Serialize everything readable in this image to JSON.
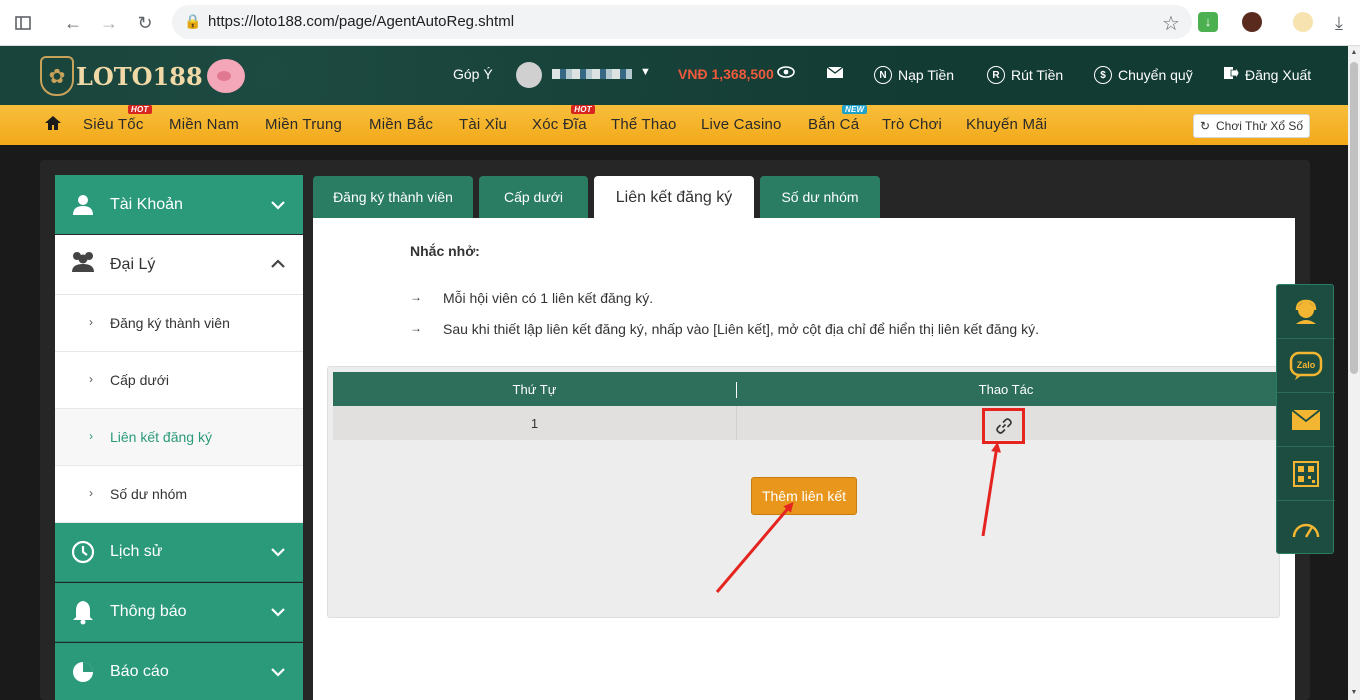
{
  "browser": {
    "url": "https://loto188.com/page/AgentAutoReg.shtml"
  },
  "header": {
    "logo_text": "LOTO188",
    "feedback": "Góp Ý",
    "balance": "VNĐ 1,368,500",
    "deposit": "Nạp Tiền",
    "deposit_icon_letter": "N",
    "withdraw": "Rút Tiền",
    "withdraw_icon_letter": "R",
    "transfer": "Chuyển quỹ",
    "logout": "Đăng Xuất"
  },
  "nav": {
    "items": [
      {
        "label": "Siêu Tốc",
        "badge": "HOT"
      },
      {
        "label": "Miền Nam"
      },
      {
        "label": "Miền Trung"
      },
      {
        "label": "Miền Bắc"
      },
      {
        "label": "Tài Xỉu"
      },
      {
        "label": "Xóc Đĩa",
        "badge": "HOT"
      },
      {
        "label": "Thể Thao"
      },
      {
        "label": "Live Casino"
      },
      {
        "label": "Bắn Cá",
        "badge": "NEW"
      },
      {
        "label": "Trò Chơi"
      },
      {
        "label": "Khuyến Mãi"
      }
    ],
    "try_lottery": "Chơi Thử Xổ Số"
  },
  "sidebar": {
    "account": "Tài Khoản",
    "agent": "Đại Lý",
    "sub_items": [
      "Đăng ký thành viên",
      "Cấp dưới",
      "Liên kết đăng ký",
      "Số dư nhóm"
    ],
    "history": "Lịch sử",
    "notifications": "Thông báo",
    "reports": "Báo cáo"
  },
  "tabs": [
    "Đăng ký thành viên",
    "Cấp dưới",
    "Liên kết đăng ký",
    "Số dư nhóm"
  ],
  "reminder": {
    "title": "Nhắc nhở:",
    "lines": [
      "Mỗi hội viên có 1 liên kết đăng ký.",
      "Sau khi thiết lập liên kết đăng ký, nhấp vào [Liên kết], mở cột địa chỉ để hiển thị liên kết đăng ký."
    ]
  },
  "table": {
    "columns": [
      "Thứ Tự",
      "Thao Tác"
    ],
    "rows": [
      {
        "order": "1"
      }
    ]
  },
  "add_link_button": "Thêm liên kết",
  "colors": {
    "brand_green": "#2a9a7b",
    "nav_yellow": "#f3a919",
    "accent_orange": "#e8961c",
    "annotation_red": "#e52420"
  }
}
